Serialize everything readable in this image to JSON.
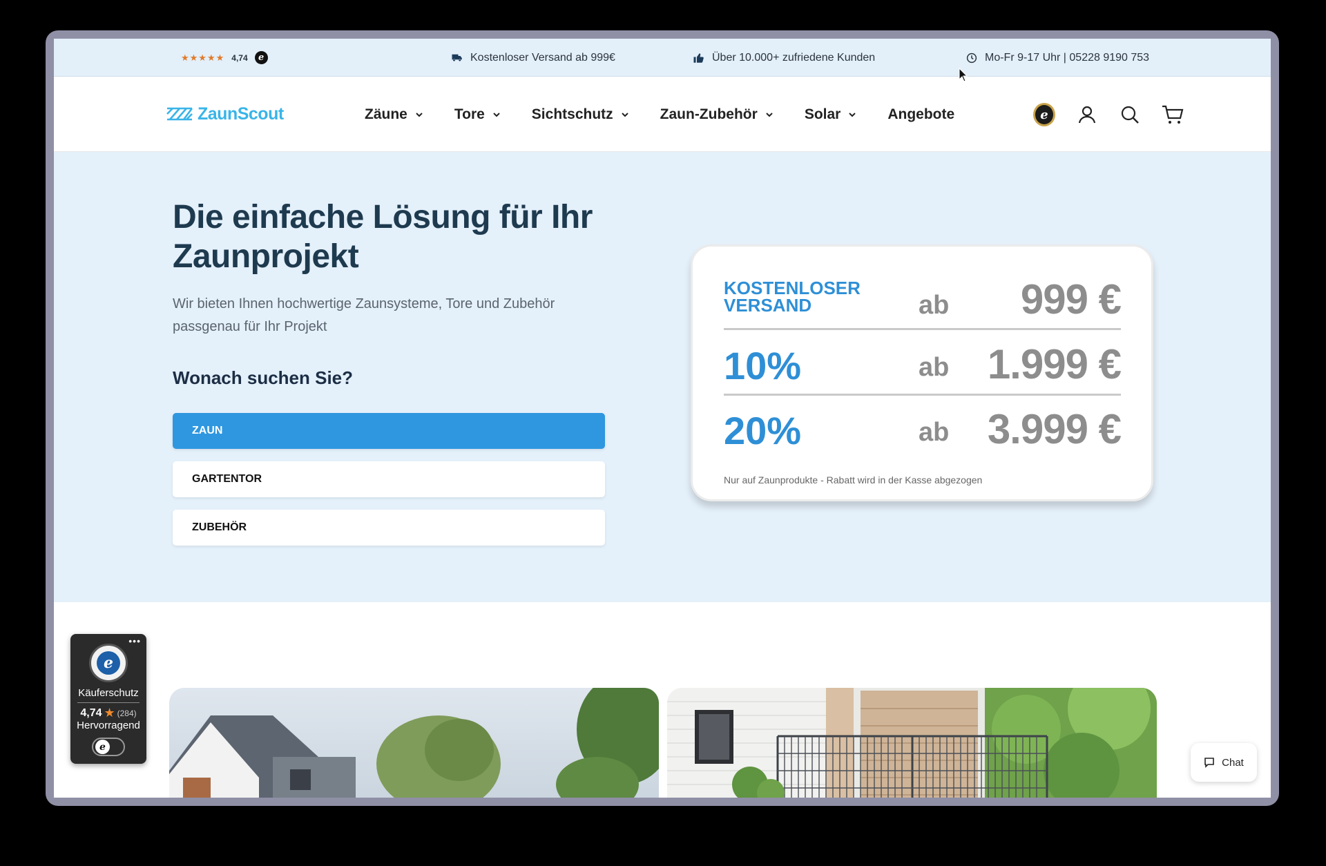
{
  "topbar": {
    "stars": "★★★★★",
    "rating": "4,74",
    "shipping": "Kostenloser Versand ab 999€",
    "customers": "Über 10.000+ zufriedene Kunden",
    "hours": "Mo-Fr 9-17 Uhr | 05228 9190 753"
  },
  "header": {
    "logo": "ZaunScout",
    "nav": [
      {
        "label": "Zäune"
      },
      {
        "label": "Tore"
      },
      {
        "label": "Sichtschutz"
      },
      {
        "label": "Zaun-Zubehör"
      },
      {
        "label": "Solar"
      },
      {
        "label": "Angebote"
      }
    ]
  },
  "hero": {
    "title": "Die einfache Lösung für Ihr Zaunprojekt",
    "subtitle": "Wir bieten Ihnen hochwertige Zaunsysteme, Tore und Zubehör passgenau für Ihr Projekt",
    "question": "Wonach suchen Sie?",
    "categories": [
      {
        "label": "ZAUN",
        "active": true
      },
      {
        "label": "GARTENTOR",
        "active": false
      },
      {
        "label": "ZUBEHÖR",
        "active": false
      }
    ]
  },
  "discount": {
    "rows": [
      {
        "label_line1": "KOSTENLOSER",
        "label_line2": "VERSAND",
        "ab": "ab",
        "amount": "999 €"
      },
      {
        "label": "10%",
        "ab": "ab",
        "amount": "1.999 €"
      },
      {
        "label": "20%",
        "ab": "ab",
        "amount": "3.999 €"
      }
    ],
    "note": "Nur auf Zaunprodukte - Rabatt wird in der Kasse abgezogen"
  },
  "trusted": {
    "label": "Käuferschutz",
    "score": "4,74",
    "count": "(284)",
    "grade": "Hervorragend"
  },
  "chat": {
    "label": "Chat"
  },
  "colors": {
    "accent": "#2f97e0",
    "logo": "#39b4e8",
    "hero_bg": "#e4f0fa",
    "heading": "#1e3a4f"
  }
}
